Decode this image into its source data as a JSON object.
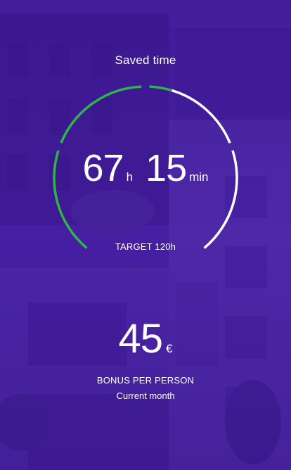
{
  "saved_time": {
    "title": "Saved time",
    "hours_value": "67",
    "hours_unit": "h",
    "minutes_value": "15",
    "minutes_unit": "min",
    "target_label": "TARGET 120h",
    "progress_fraction": 0.56
  },
  "bonus": {
    "amount": "45",
    "currency": "€",
    "label": "BONUS PER PERSON",
    "period": "Current month"
  },
  "colors": {
    "overlay": "#3b1593",
    "gauge_progress": "#2fb34a",
    "gauge_remaining": "#ffffff",
    "text": "#ffffff"
  }
}
